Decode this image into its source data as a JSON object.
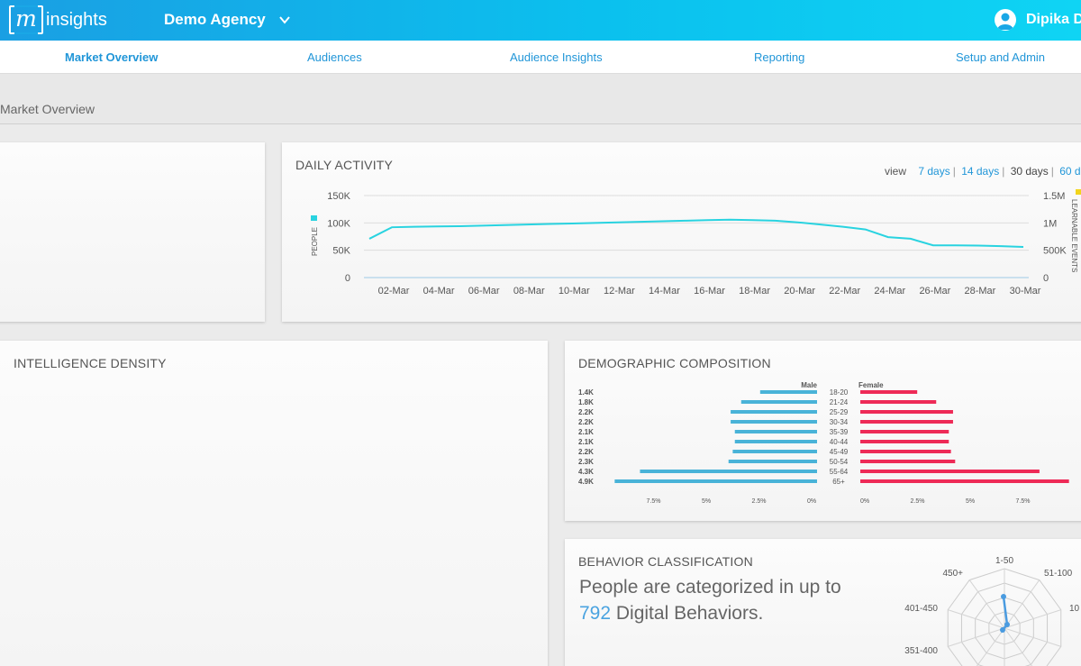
{
  "header": {
    "logo_letter": "m",
    "logo_word": "insights",
    "agency": "Demo Agency",
    "user_name": "Dipika D"
  },
  "nav": {
    "items": [
      "Market Overview",
      "Audiences",
      "Audience Insights",
      "Reporting",
      "Setup and Admin"
    ],
    "active": "Market Overview"
  },
  "breadcrumb": "Market Overview",
  "daily_activity": {
    "title": "DAILY ACTIVITY",
    "view_label": "view",
    "options": [
      "7 days",
      "14 days",
      "30 days",
      "60 d"
    ],
    "selected": "30 days",
    "left_axis_label": "PEOPLE",
    "right_axis_label": "LEARNABLE EVENTS",
    "colors": {
      "people": "#29d3e0",
      "events": "#f2d51c"
    }
  },
  "intelligence_density": {
    "title": "INTELLIGENCE DENSITY"
  },
  "demographic": {
    "title": "DEMOGRAPHIC COMPOSITION",
    "male_label": "Male",
    "female_label": "Female",
    "colors": {
      "male": "#49b3d8",
      "female": "#ee2a57"
    }
  },
  "behavior": {
    "title": "BEHAVIOR CLASSIFICATION",
    "text_pre": "People are categorized in up to ",
    "count": "792",
    "text_post": " Digital Behaviors.",
    "radar_labels": [
      "1-50",
      "51-100",
      "10",
      "450+",
      "401-450",
      "351-400"
    ]
  },
  "chart_data": [
    {
      "type": "line",
      "title": "DAILY ACTIVITY",
      "x": [
        "01-Mar",
        "02-Mar",
        "03-Mar",
        "04-Mar",
        "05-Mar",
        "06-Mar",
        "07-Mar",
        "08-Mar",
        "09-Mar",
        "10-Mar",
        "11-Mar",
        "12-Mar",
        "13-Mar",
        "14-Mar",
        "15-Mar",
        "16-Mar",
        "17-Mar",
        "18-Mar",
        "19-Mar",
        "20-Mar",
        "21-Mar",
        "22-Mar",
        "23-Mar",
        "24-Mar",
        "25-Mar",
        "26-Mar",
        "27-Mar",
        "28-Mar",
        "29-Mar",
        "30-Mar"
      ],
      "xticks": [
        "02-Mar",
        "04-Mar",
        "06-Mar",
        "08-Mar",
        "10-Mar",
        "12-Mar",
        "14-Mar",
        "16-Mar",
        "18-Mar",
        "20-Mar",
        "22-Mar",
        "24-Mar",
        "26-Mar",
        "28-Mar",
        "30-Mar"
      ],
      "series": [
        {
          "name": "PEOPLE",
          "axis": "left",
          "values": [
            71000,
            92000,
            93000,
            93500,
            94000,
            95000,
            96000,
            97000,
            98000,
            99000,
            100000,
            101000,
            102000,
            103000,
            104000,
            105000,
            106000,
            105000,
            104000,
            101000,
            97000,
            93000,
            88000,
            74000,
            71000,
            59000,
            59000,
            58500,
            57500,
            56000
          ]
        }
      ],
      "ylabel": "PEOPLE",
      "y2label": "LEARNABLE EVENTS",
      "yticks": [
        "0",
        "50K",
        "100K",
        "150K"
      ],
      "y2ticks": [
        "0",
        "500K",
        "1M",
        "1.5M"
      ],
      "ylim": [
        0,
        150000
      ],
      "y2lim": [
        0,
        1500000
      ],
      "grid": true
    },
    {
      "type": "bar",
      "title": "DEMOGRAPHIC COMPOSITION",
      "categories": [
        "18-20",
        "21-24",
        "25-29",
        "30-34",
        "35-39",
        "40-44",
        "45-49",
        "50-54",
        "55-64",
        "65+"
      ],
      "totals": [
        "1.4K",
        "1.8K",
        "2.2K",
        "2.2K",
        "2.1K",
        "2.1K",
        "2.2K",
        "2.3K",
        "4.3K",
        "4.9K"
      ],
      "series": [
        {
          "name": "Male",
          "values": [
            2.7,
            3.6,
            4.1,
            4.1,
            3.9,
            3.9,
            4.0,
            4.2,
            8.4,
            9.6
          ]
        },
        {
          "name": "Female",
          "values": [
            2.7,
            3.6,
            4.4,
            4.4,
            4.2,
            4.2,
            4.3,
            4.5,
            8.5,
            9.9
          ]
        }
      ],
      "xticks_male": [
        "7.5%",
        "5%",
        "2.5%",
        "0%"
      ],
      "xticks_female": [
        "0%",
        "2.5%",
        "5%",
        "7.5%"
      ],
      "xlim": [
        0,
        10
      ]
    }
  ]
}
